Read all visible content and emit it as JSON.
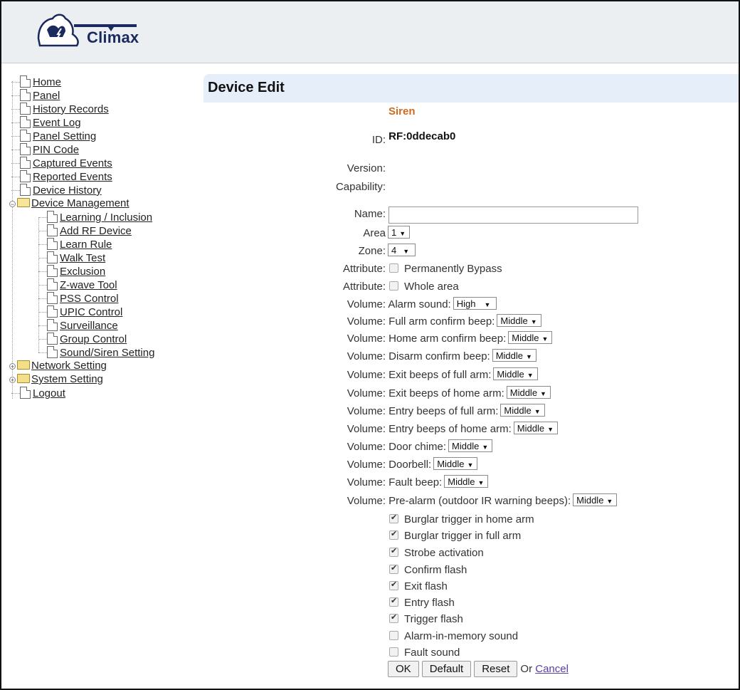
{
  "header": {
    "brand": "Climax"
  },
  "sidebar": {
    "items": [
      {
        "label": "Home"
      },
      {
        "label": "Panel"
      },
      {
        "label": "History Records"
      },
      {
        "label": "Event Log"
      },
      {
        "label": "Panel Setting"
      },
      {
        "label": "PIN Code"
      },
      {
        "label": "Captured Events"
      },
      {
        "label": "Reported Events"
      },
      {
        "label": "Device History"
      },
      {
        "label": "Device Management"
      },
      {
        "label": "Learning / Inclusion"
      },
      {
        "label": "Add RF Device"
      },
      {
        "label": "Learn Rule"
      },
      {
        "label": "Walk Test"
      },
      {
        "label": "Exclusion"
      },
      {
        "label": "Z-wave Tool"
      },
      {
        "label": "PSS Control"
      },
      {
        "label": "UPIC Control"
      },
      {
        "label": "Surveillance"
      },
      {
        "label": "Group Control"
      },
      {
        "label": "Sound/Siren Setting"
      },
      {
        "label": "Network Setting"
      },
      {
        "label": "System Setting"
      },
      {
        "label": "Logout"
      }
    ]
  },
  "main": {
    "title": "Device Edit",
    "device_type": "Siren",
    "id_label": "ID:",
    "id_value": "RF:0ddecab0",
    "version_label": "Version:",
    "capability_label": "Capability:",
    "name_label": "Name:",
    "name_value": "",
    "area_label": "Area",
    "area_value": "1",
    "zone_label": "Zone:",
    "zone_value": "4",
    "attribute_label": "Attribute:",
    "attr_bypass": "Permanently Bypass",
    "attr_whole": "Whole area",
    "volume_label": "Volume:",
    "volumes": [
      {
        "name": "Alarm sound:",
        "value": "High"
      },
      {
        "name": "Full arm confirm beep:",
        "value": "Middle"
      },
      {
        "name": "Home arm confirm beep:",
        "value": "Middle"
      },
      {
        "name": "Disarm confirm beep:",
        "value": "Middle"
      },
      {
        "name": "Exit beeps of full arm:",
        "value": "Middle"
      },
      {
        "name": "Exit beeps of home arm:",
        "value": "Middle"
      },
      {
        "name": "Entry beeps of full arm:",
        "value": "Middle"
      },
      {
        "name": "Entry beeps of home arm:",
        "value": "Middle"
      },
      {
        "name": "Door chime:",
        "value": "Middle"
      },
      {
        "name": "Doorbell:",
        "value": "Middle"
      },
      {
        "name": "Fault beep:",
        "value": "Middle"
      },
      {
        "name": "Pre-alarm (outdoor IR warning beeps):",
        "value": "Middle"
      }
    ],
    "options": [
      {
        "label": "Burglar trigger in home arm",
        "checked": true
      },
      {
        "label": "Burglar trigger in full arm",
        "checked": true
      },
      {
        "label": "Strobe activation",
        "checked": true
      },
      {
        "label": "Confirm flash",
        "checked": true
      },
      {
        "label": "Exit flash",
        "checked": true
      },
      {
        "label": "Entry flash",
        "checked": true
      },
      {
        "label": "Trigger flash",
        "checked": true
      },
      {
        "label": "Alarm-in-memory sound",
        "checked": false
      },
      {
        "label": "Fault sound",
        "checked": false
      }
    ],
    "buttons": {
      "ok": "OK",
      "default": "Default",
      "reset": "Reset",
      "or": "Or",
      "cancel": "Cancel"
    }
  }
}
